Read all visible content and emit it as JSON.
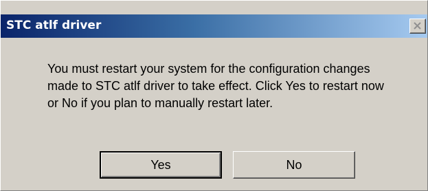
{
  "dialog": {
    "title": "STC atlf driver",
    "message": "You must restart your system for the configuration changes made to STC atlf driver to take effect. Click Yes to restart now or No if you plan to manually restart later.",
    "buttons": {
      "yes_label": "Yes",
      "no_label": "No"
    },
    "close_icon": "close-icon"
  },
  "colors": {
    "titlebar_start": "#0a246a",
    "titlebar_end": "#a6caf0",
    "face": "#d4d0c8",
    "title_text": "#ffffff"
  }
}
